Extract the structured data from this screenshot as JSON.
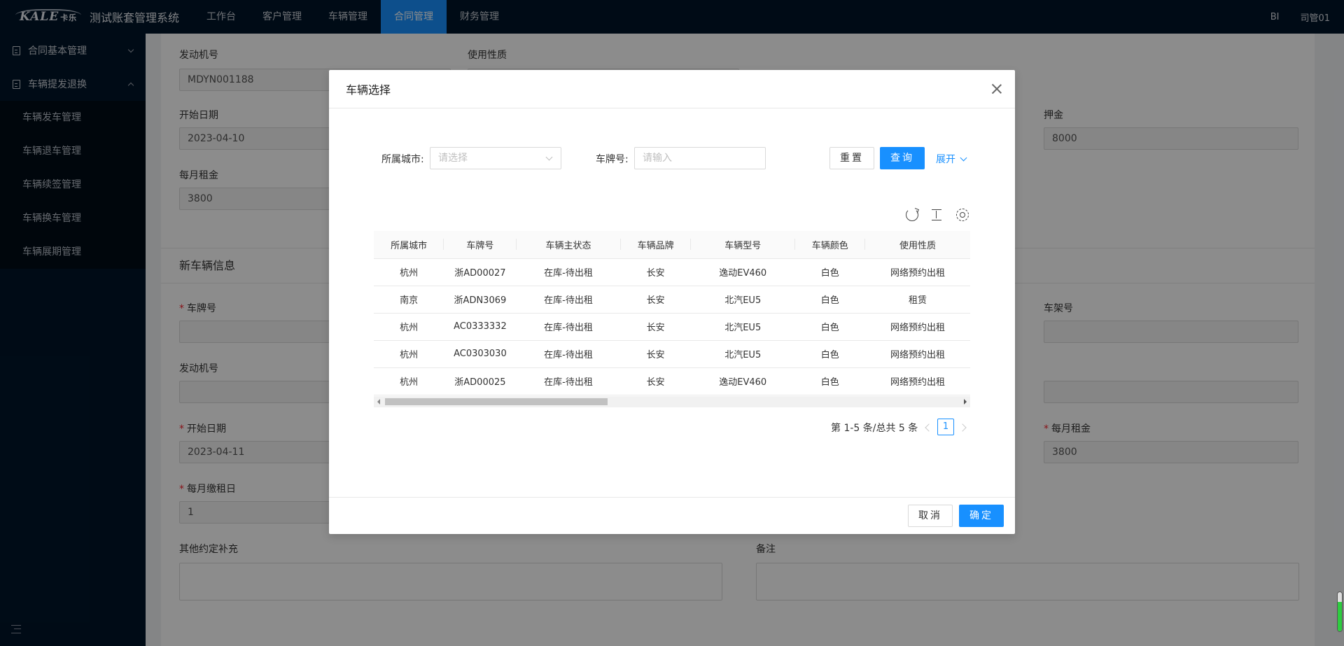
{
  "header": {
    "logo_text": "KALE",
    "logo_sub": "卡乐",
    "title": "测试账套管理系统",
    "nav": [
      "工作台",
      "客户管理",
      "车辆管理",
      "合同管理",
      "财务管理"
    ],
    "active_nav": "合同管理",
    "bi_label": "BI",
    "user": "司管01"
  },
  "sidebar": {
    "group1": "合同基本管理",
    "group2": "车辆提发退换",
    "sub_items": [
      "车辆发车管理",
      "车辆退车管理",
      "车辆续签管理",
      "车辆换车管理",
      "车辆展期管理"
    ]
  },
  "form": {
    "engine_no_label": "发动机号",
    "engine_no_value": "MDYN001188",
    "use_type_label": "使用性质",
    "start_date_label": "开始日期",
    "start_date_value": "2023-04-10",
    "deposit_label": "押金",
    "deposit_value": "8000",
    "monthly_rent_label": "每月租金",
    "monthly_rent_value": "3800",
    "new_vehicle_section": "新车辆信息",
    "plate_label": "车牌号",
    "vin_label": "车架号",
    "engine_no2_label": "发动机号",
    "start_date2_label": "开始日期",
    "start_date2_value": "2023-04-11",
    "monthly_rent2_label": "每月租金",
    "monthly_rent2_value": "3800",
    "pay_day_label": "每月缴租日",
    "pay_day_value": "1",
    "other_label": "其他约定补充",
    "remark_label": "备注"
  },
  "modal": {
    "title": "车辆选择",
    "city_label": "所属城市:",
    "city_placeholder": "请选择",
    "plate_label": "车牌号:",
    "plate_placeholder": "请输入",
    "reset_label": "重置",
    "query_label": "查询",
    "expand_label": "展开",
    "columns": [
      "所属城市",
      "车牌号",
      "车辆主状态",
      "车辆品牌",
      "车辆型号",
      "车辆颜色",
      "使用性质"
    ],
    "rows": [
      [
        "杭州",
        "浙AD00027",
        "在库-待出租",
        "长安",
        "逸动EV460",
        "白色",
        "网络预约出租"
      ],
      [
        "南京",
        "浙ADN3069",
        "在库-待出租",
        "长安",
        "北汽EU5",
        "白色",
        "租赁"
      ],
      [
        "杭州",
        "AC0333332",
        "在库-待出租",
        "长安",
        "北汽EU5",
        "白色",
        "网络预约出租"
      ],
      [
        "杭州",
        "AC0303030",
        "在库-待出租",
        "长安",
        "北汽EU5",
        "白色",
        "网络预约出租"
      ],
      [
        "杭州",
        "浙AD00025",
        "在库-待出租",
        "长安",
        "逸动EV460",
        "白色",
        "网络预约出租"
      ]
    ],
    "pager_total": "第 1-5 条/总共 5 条",
    "current_page": "1",
    "cancel_label": "取消",
    "ok_label": "确定"
  },
  "colors": {
    "primary": "#1890ff",
    "nav_bg": "#001529",
    "required": "#f5222d"
  },
  "corner_gauge_level": 0.75
}
